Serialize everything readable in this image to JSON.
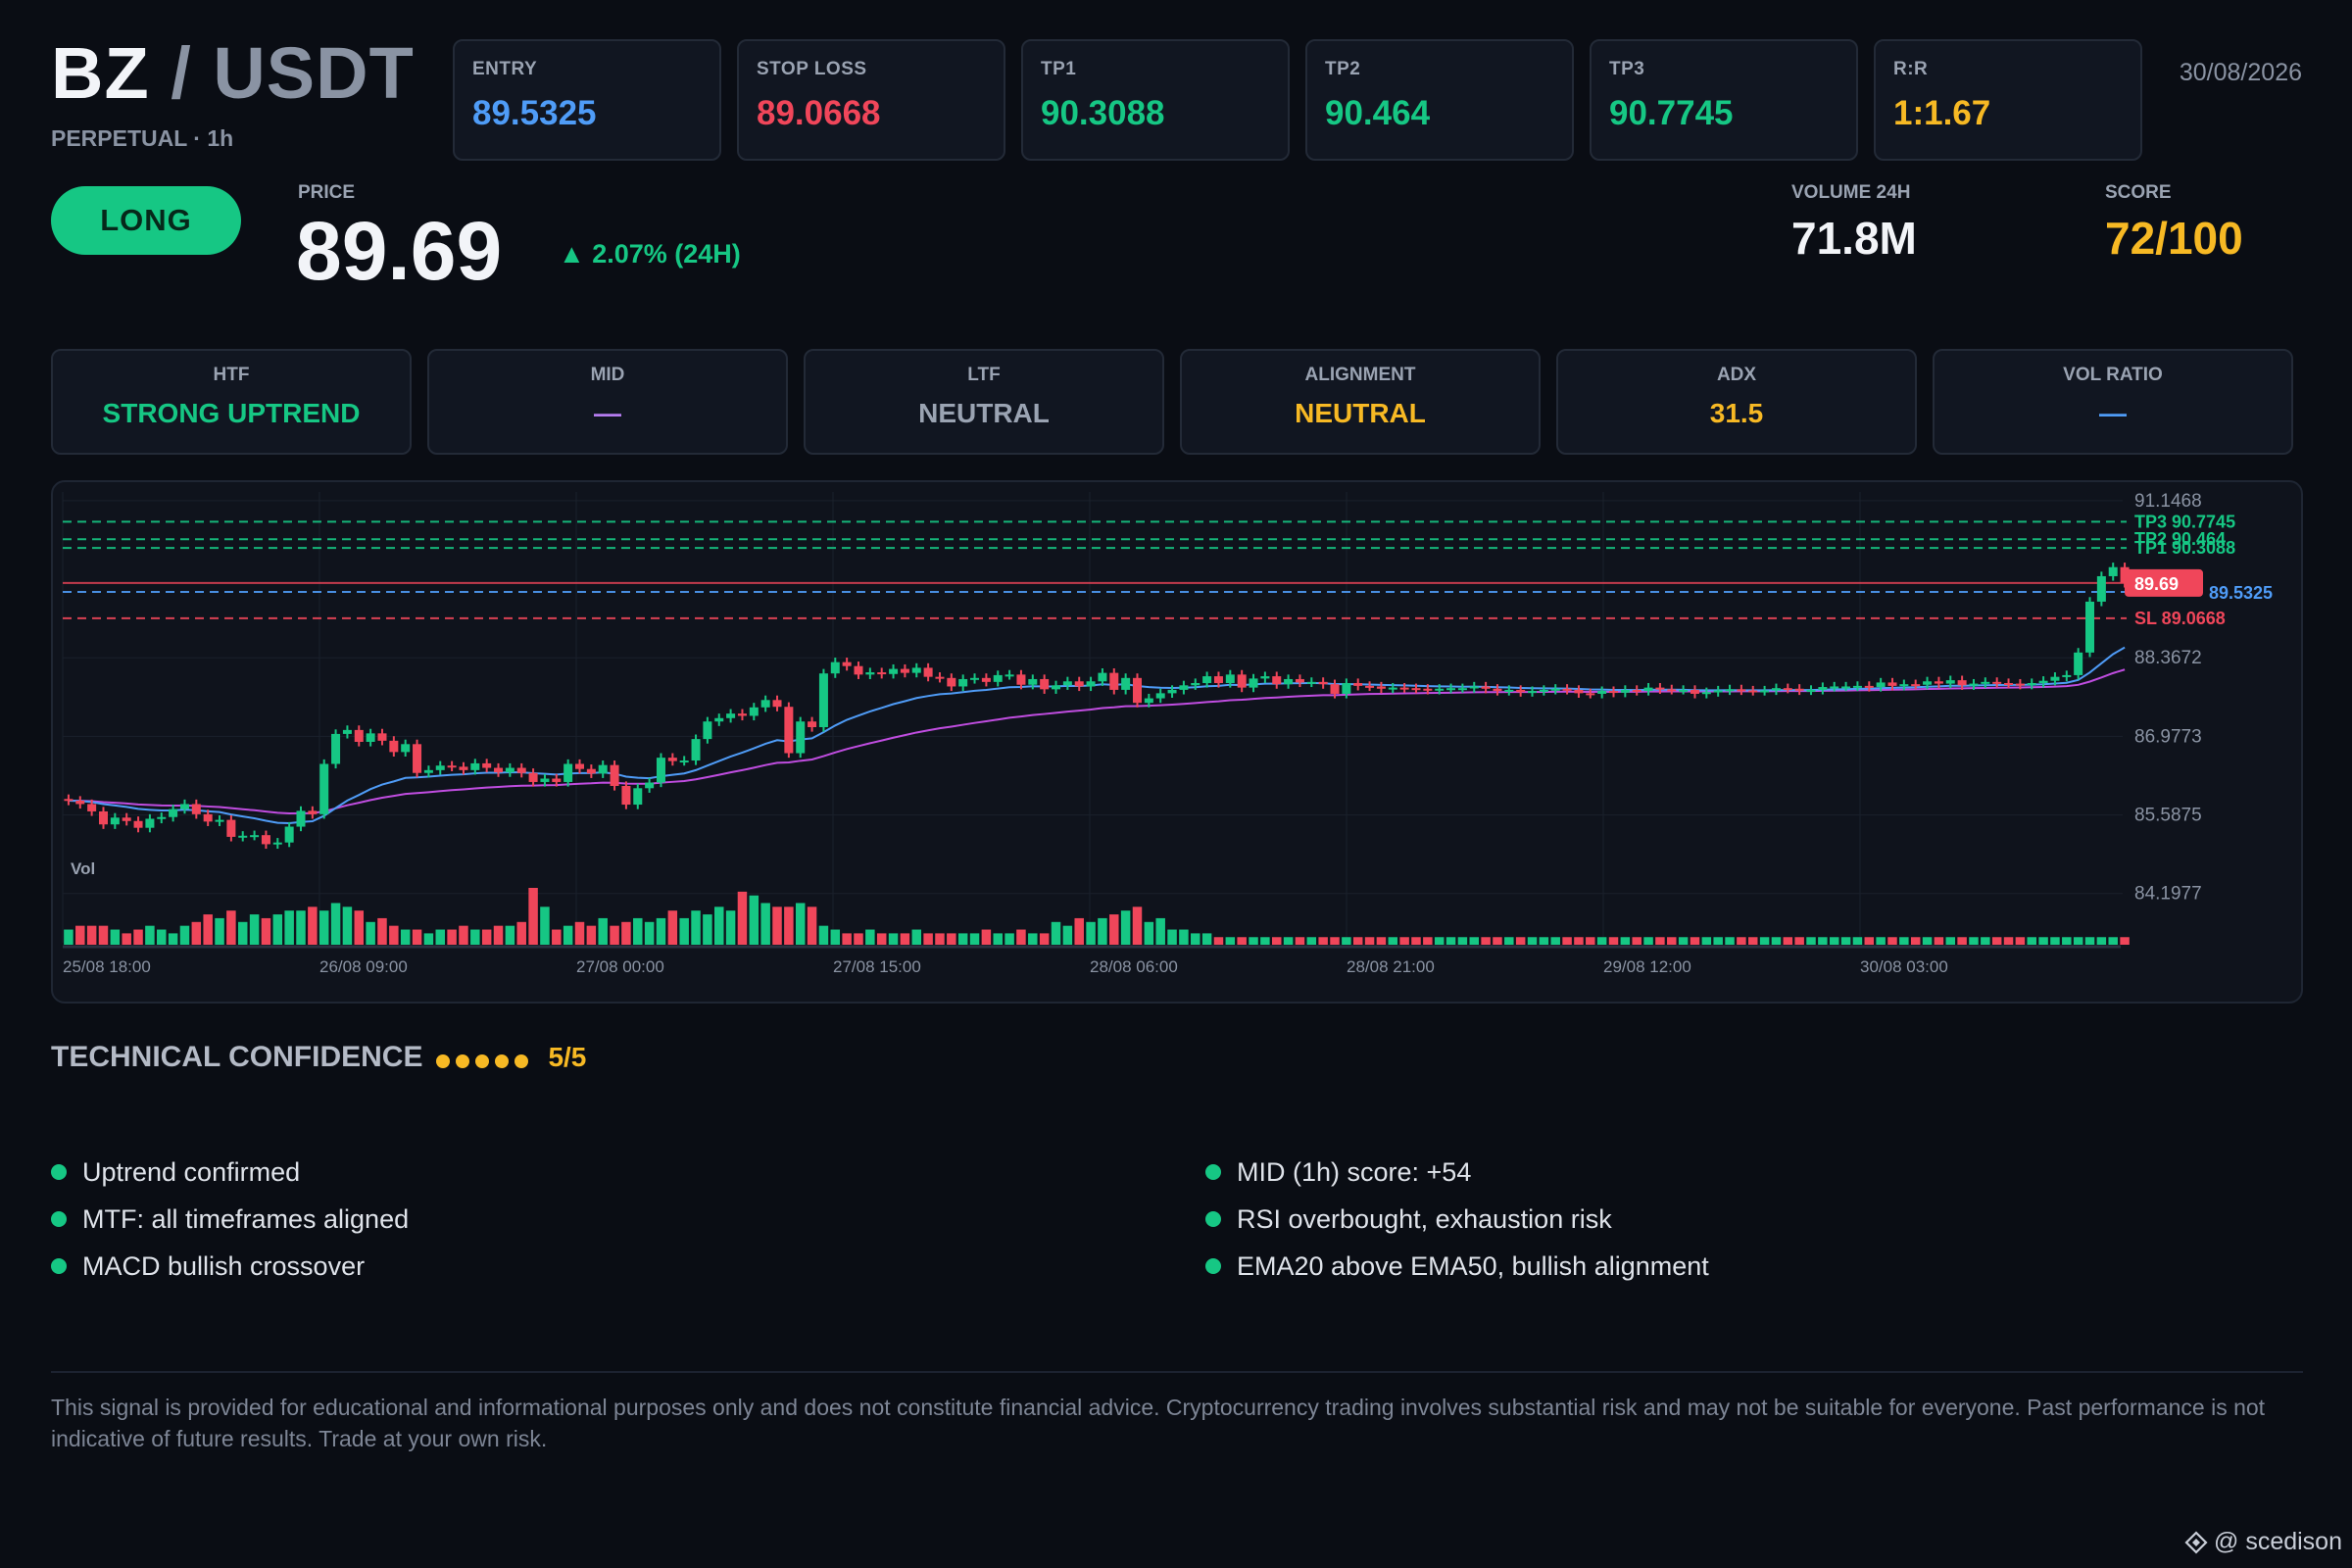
{
  "header": {
    "base": "BZ",
    "slash": "/",
    "quote": "USDT",
    "subtitle": "PERPETUAL · 1h",
    "date": "30/08/2026"
  },
  "levels": [
    {
      "label": "ENTRY",
      "value": "89.5325",
      "color": "#4f9cf7"
    },
    {
      "label": "STOP LOSS",
      "value": "89.0668",
      "color": "#f0465a"
    },
    {
      "label": "TP1",
      "value": "90.3088",
      "color": "#16c784"
    },
    {
      "label": "TP2",
      "value": "90.464",
      "color": "#16c784"
    },
    {
      "label": "TP3",
      "value": "90.7745",
      "color": "#16c784"
    },
    {
      "label": "R:R",
      "value": "1:1.67",
      "color": "#f7b924"
    }
  ],
  "direction": "LONG",
  "price": {
    "label": "PRICE",
    "value": "89.69",
    "change": "▲ 2.07% (24H)"
  },
  "volume": {
    "label": "VOLUME 24H",
    "value": "71.8M"
  },
  "score": {
    "label": "SCORE",
    "value": "72/100"
  },
  "stats": [
    {
      "label": "HTF",
      "value": "STRONG UPTREND",
      "color": "#16c784"
    },
    {
      "label": "MID",
      "value": "—",
      "color": "#b57cf0"
    },
    {
      "label": "LTF",
      "value": "NEUTRAL",
      "color": "#9aa3b2"
    },
    {
      "label": "ALIGNMENT",
      "value": "NEUTRAL",
      "color": "#f7b924"
    },
    {
      "label": "ADX",
      "value": "31.5",
      "color": "#f7b924"
    },
    {
      "label": "VOL RATIO",
      "value": "—",
      "color": "#4f9cf7"
    }
  ],
  "chart_data": {
    "type": "candlestick",
    "y_ticks": [
      "91.1468",
      "88.3672",
      "86.9773",
      "85.5875",
      "84.1977"
    ],
    "x_ticks": [
      "25/08 18:00",
      "26/08 09:00",
      "27/08 00:00",
      "27/08 15:00",
      "28/08 06:00",
      "28/08 21:00",
      "29/08 12:00",
      "30/08 03:00"
    ],
    "ylim": [
      83.5,
      91.3
    ],
    "volume_label": "Vol",
    "price_lines": [
      {
        "label": "TP3 90.7745",
        "value": 90.7745,
        "color": "#16c784"
      },
      {
        "label": "TP2 90.464",
        "value": 90.464,
        "color": "#16c784"
      },
      {
        "label": "TP1 90.3088",
        "value": 90.3088,
        "color": "#16c784"
      },
      {
        "label": "89.5325",
        "value": 89.5325,
        "color": "#4f9cf7"
      },
      {
        "label": "SL 89.0668",
        "value": 89.0668,
        "color": "#f0465a"
      }
    ],
    "current_price": {
      "label": "89.69",
      "value": 89.69,
      "color": "#f0465a"
    },
    "closes": [
      85.84,
      85.78,
      85.65,
      85.42,
      85.54,
      85.48,
      85.36,
      85.52,
      85.55,
      85.69,
      85.78,
      85.6,
      85.47,
      85.5,
      85.2,
      85.22,
      85.23,
      85.07,
      85.1,
      85.38,
      85.66,
      85.6,
      86.49,
      87.02,
      87.09,
      86.88,
      87.03,
      86.9,
      86.7,
      86.84,
      86.33,
      86.38,
      86.46,
      86.44,
      86.38,
      86.5,
      86.42,
      86.34,
      86.42,
      86.33,
      86.17,
      86.23,
      86.17,
      86.49,
      86.4,
      86.32,
      86.47,
      86.1,
      85.77,
      86.06,
      86.16,
      86.6,
      86.54,
      86.55,
      86.93,
      87.24,
      87.3,
      87.38,
      87.34,
      87.49,
      87.62,
      87.5,
      86.68,
      87.24,
      87.14,
      88.09,
      88.29,
      88.22,
      88.07,
      88.11,
      88.08,
      88.17,
      88.1,
      88.19,
      88.03,
      88.01,
      87.86,
      87.99,
      88.01,
      87.94,
      88.06,
      88.07,
      87.89,
      87.99,
      87.81,
      87.88,
      87.95,
      87.86,
      87.95,
      88.1,
      87.8,
      88.01,
      87.57,
      87.65,
      87.74,
      87.8,
      87.88,
      87.92,
      88.04,
      87.92,
      88.07,
      87.84,
      88.0,
      88.04,
      87.9,
      87.99,
      87.93,
      87.94,
      87.9,
      87.73,
      87.92,
      87.87,
      87.86,
      87.82,
      87.84,
      87.83,
      87.82,
      87.8,
      87.82,
      87.83,
      87.83,
      87.86,
      87.82,
      87.78,
      87.8,
      87.76,
      87.78,
      87.8,
      87.82,
      87.8,
      87.74,
      87.73,
      87.78,
      87.75,
      87.8,
      87.78,
      87.84,
      87.81,
      87.8,
      87.8,
      87.73,
      87.76,
      87.79,
      87.81,
      87.79,
      87.78,
      87.79,
      87.83,
      87.82,
      87.79,
      87.8,
      87.85,
      87.86,
      87.86,
      87.87,
      87.85,
      87.93,
      87.87,
      87.9,
      87.89,
      87.95,
      87.91,
      87.97,
      87.88,
      87.91,
      87.94,
      87.92,
      87.91,
      87.89,
      87.92,
      87.96,
      88.03,
      88.06,
      88.46,
      89.36,
      89.81,
      89.97,
      89.69
    ],
    "volumes": [
      4,
      5,
      5,
      5,
      4,
      3,
      4,
      5,
      4,
      3,
      5,
      6,
      8,
      7,
      9,
      6,
      8,
      7,
      8,
      9,
      9,
      10,
      9,
      11,
      10,
      9,
      6,
      7,
      5,
      4,
      4,
      3,
      4,
      4,
      5,
      4,
      4,
      5,
      5,
      6,
      15,
      10,
      4,
      5,
      6,
      5,
      7,
      5,
      6,
      7,
      6,
      7,
      9,
      7,
      9,
      8,
      10,
      9,
      14,
      13,
      11,
      10,
      10,
      11,
      10,
      5,
      4,
      3,
      3,
      4,
      3,
      3,
      3,
      4,
      3,
      3,
      3,
      3,
      3,
      4,
      3,
      3,
      4,
      3,
      3,
      6,
      5,
      7,
      6,
      7,
      8,
      9,
      10,
      6,
      7,
      4,
      4,
      3,
      3,
      2,
      2,
      2,
      2,
      2,
      2,
      2,
      2,
      2,
      2,
      2,
      2,
      2,
      2,
      2,
      2,
      2,
      2,
      2,
      2,
      2,
      2,
      2,
      2,
      2,
      2,
      2,
      2,
      2,
      2,
      2,
      2,
      2,
      2,
      2,
      2,
      2,
      2,
      2,
      2,
      2,
      2,
      2,
      2,
      2,
      2,
      2,
      2,
      2,
      2,
      2,
      2,
      2,
      2,
      2,
      2,
      2,
      2,
      2,
      2,
      2,
      2,
      2,
      2,
      2,
      2,
      2,
      2,
      2,
      2,
      2,
      2,
      2,
      2,
      2,
      2,
      2,
      2,
      2,
      2,
      2,
      2,
      2,
      2,
      2,
      2,
      2,
      2,
      5,
      7,
      7,
      6,
      6,
      6,
      5,
      6,
      6,
      6,
      6,
      5,
      6,
      6,
      6,
      6,
      6,
      6,
      5,
      6,
      5,
      6,
      7,
      7
    ]
  },
  "confidence": {
    "title": "TECHNICAL CONFIDENCE",
    "dots": 5,
    "score": "5/5"
  },
  "bullets_left": [
    "Uptrend confirmed",
    "MTF: all timeframes aligned",
    "MACD bullish crossover"
  ],
  "bullets_right": [
    "MID (1h) score: +54",
    "RSI overbought, exhaustion risk",
    "EMA20 above EMA50, bullish alignment"
  ],
  "disclaimer": "This signal is provided for educational and informational purposes only and does not constitute financial advice. Cryptocurrency trading involves substantial risk and may not be suitable for everyone. Past performance is not indicative of future results. Trade at your own risk.",
  "watermark": "@ scedison"
}
